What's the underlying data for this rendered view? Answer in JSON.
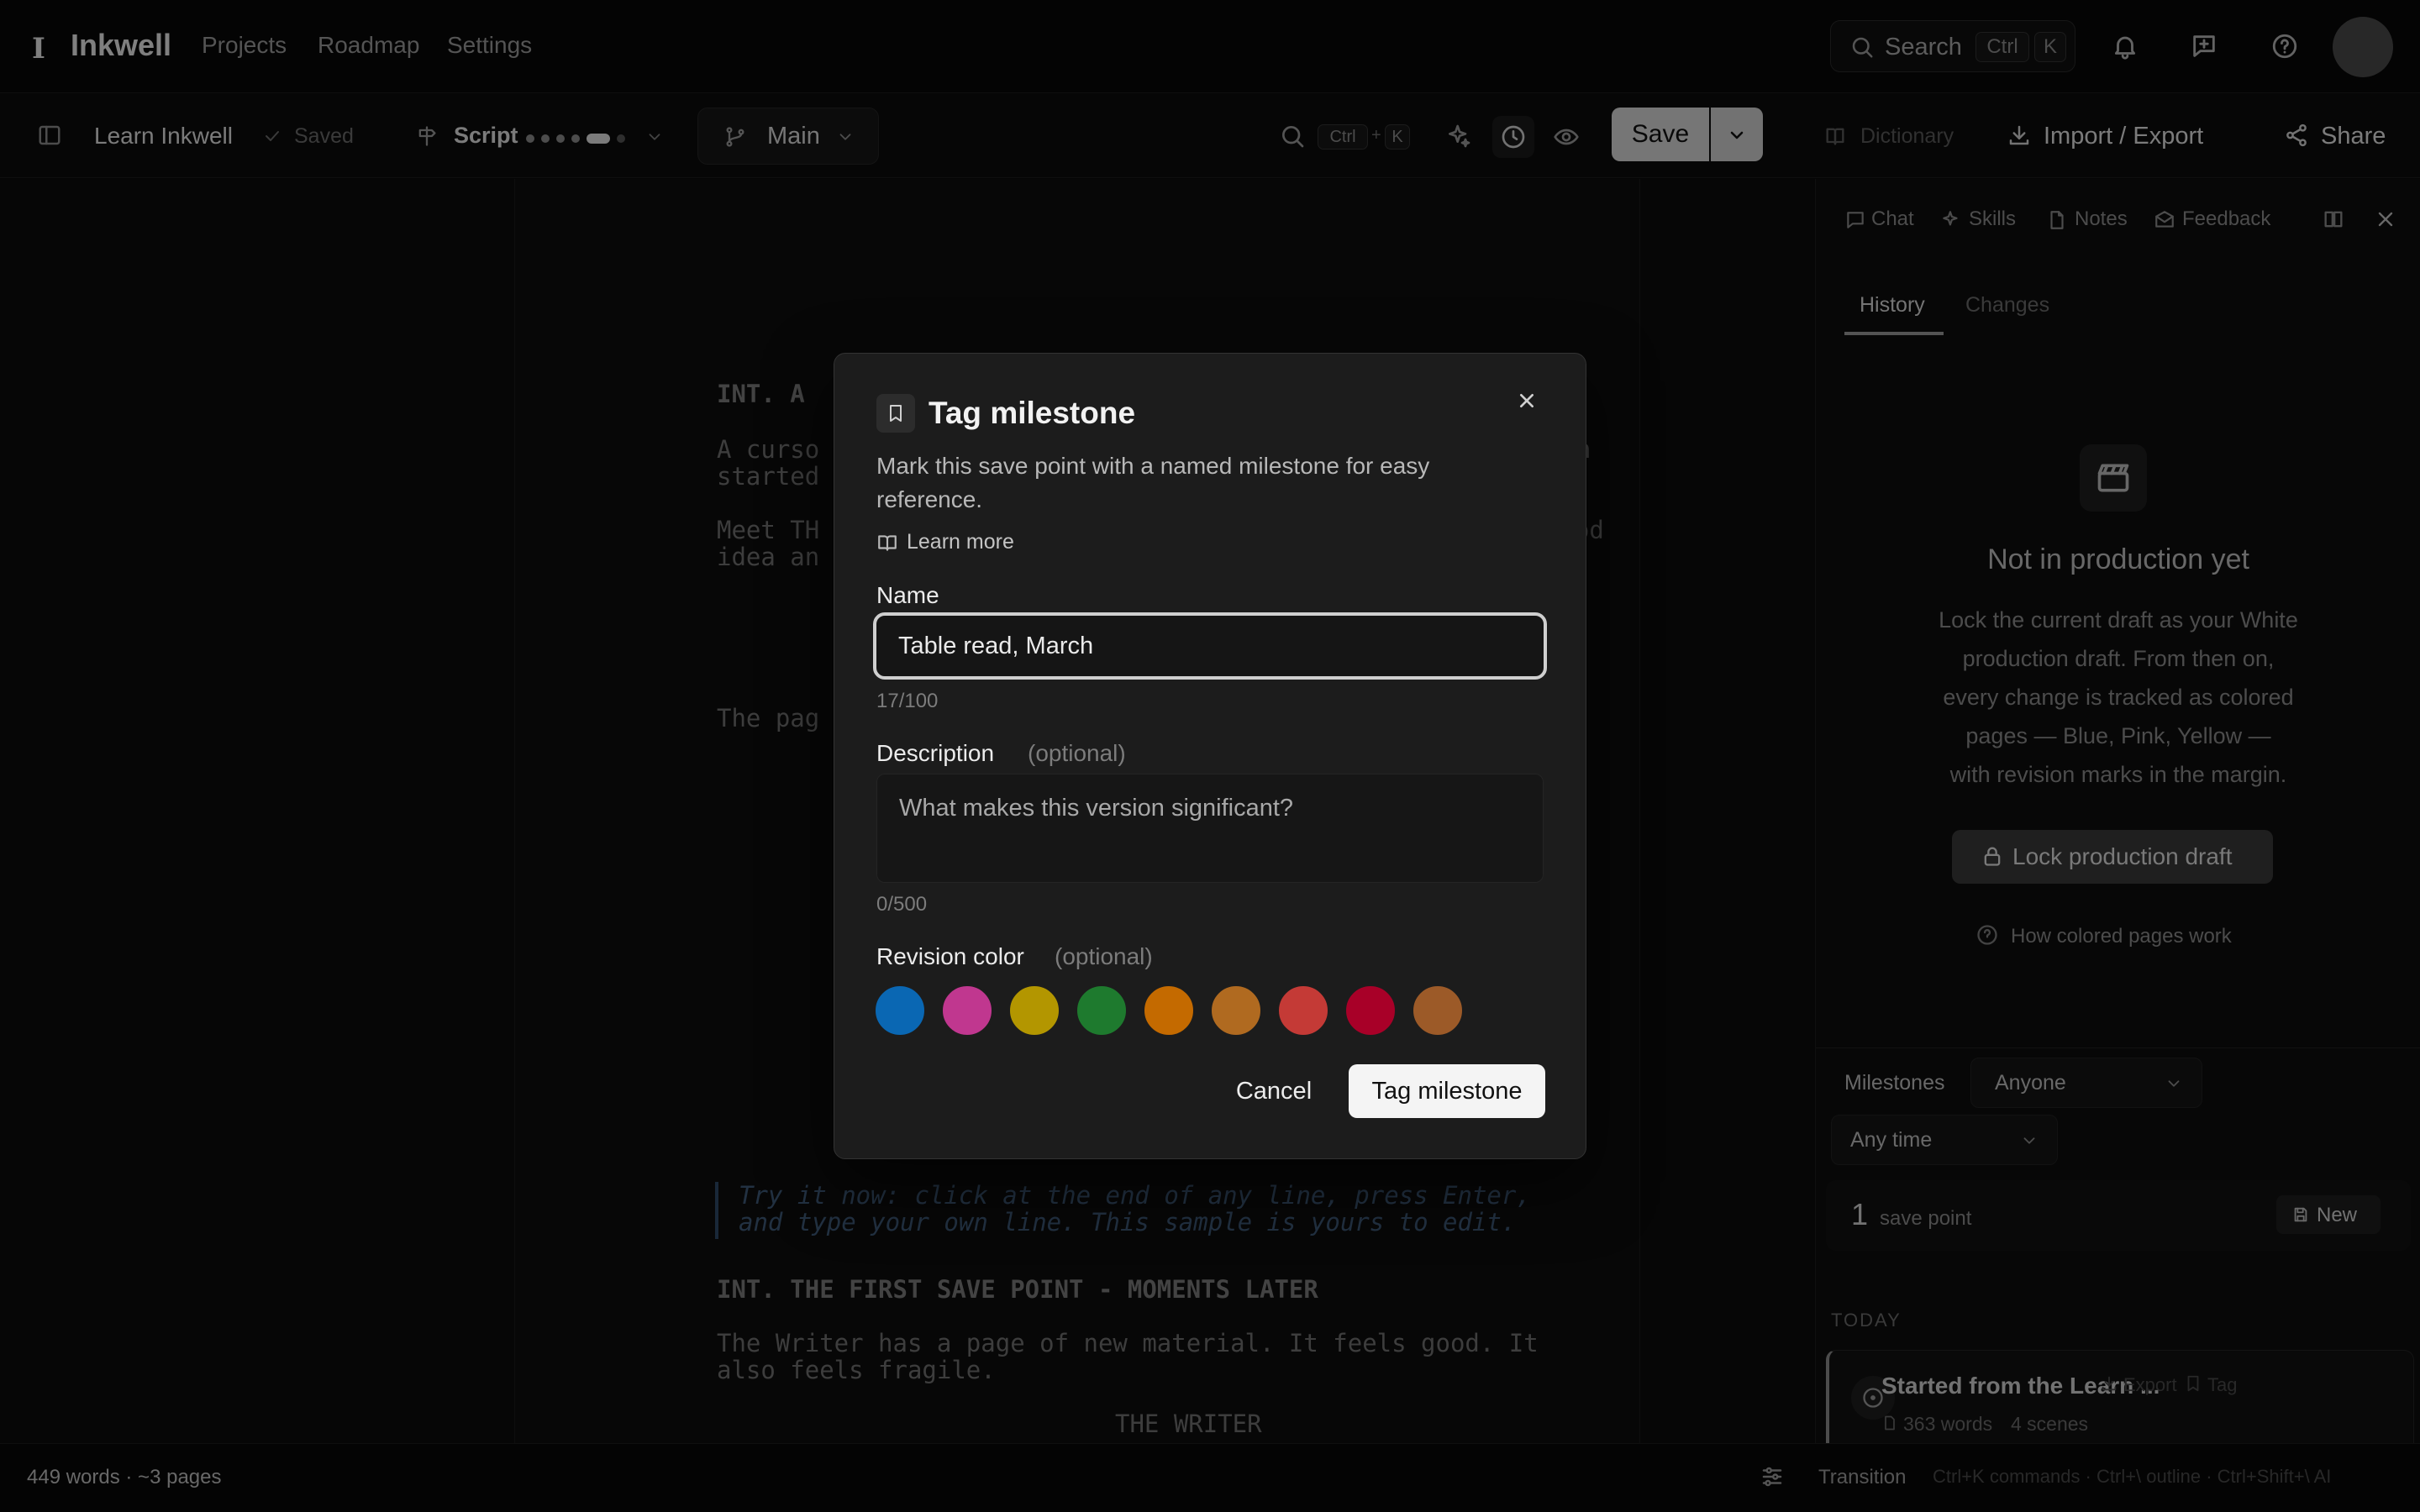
{
  "app": {
    "brand_mark": "I",
    "brand_name": "Inkwell",
    "nav": [
      "Projects",
      "Roadmap",
      "Settings"
    ],
    "search": {
      "label": "Search",
      "key1": "Ctrl",
      "key2": "K"
    }
  },
  "toolbar": {
    "doc_title": "Learn Inkwell",
    "saved_status": "Saved",
    "mode_label": "Script",
    "branch": "Main",
    "find_key1": "Ctrl",
    "find_plus": "+",
    "find_key2": "K",
    "save_label": "Save",
    "dictionary_label": "Dictionary",
    "import_export_label": "Import / Export",
    "share_label": "Share"
  },
  "script": {
    "l1": "INT. A",
    "l2a": "A curso",
    "l2a_end": "ten",
    "l2b": "started",
    "l3a": "Meet TH",
    "l3a_end": "good",
    "l3b": "idea an",
    "l4": "The pag",
    "note1": "Try it now: click at the end of any line, press Enter,",
    "note2": "and type your own line. This sample is yours to edit.",
    "scene2": "INT. THE FIRST SAVE POINT - MOMENTS LATER",
    "action1": "The Writer has a page of new material. It feels good. It",
    "action2": "also feels fragile.",
    "character": "THE WRITER"
  },
  "panel": {
    "tabs": [
      "Chat",
      "Skills",
      "Notes",
      "Feedback"
    ],
    "subtabs": {
      "history": "History",
      "changes": "Changes"
    },
    "empty_title": "Not in production yet",
    "empty_lines": [
      "Lock the current draft as your White",
      "production draft. From then on,",
      "every change is tracked as colored",
      "pages — Blue, Pink, Yellow —",
      "with revision marks in the margin."
    ],
    "lock_label": "Lock production draft",
    "help_link": "How colored pages work",
    "milestones_label": "Milestones",
    "author_filter": "Anyone",
    "time_filter": "Any time",
    "save_count": "1",
    "save_count_label": "save point",
    "new_label": "New",
    "group_label": "TODAY",
    "entry_title": "Started from the Learn ...",
    "entry_export": "Export",
    "entry_tag": "Tag",
    "entry_words": "363 words",
    "entry_scenes": "4 scenes"
  },
  "statusbar": {
    "counts": "449 words · ~3 pages",
    "element": "Transition",
    "hints": "Ctrl+K commands · Ctrl+\\ outline · Ctrl+Shift+\\ AI"
  },
  "modal": {
    "title": "Tag milestone",
    "subtitle_l1": "Mark this save point with a named milestone for easy",
    "subtitle_l2": "reference.",
    "learn_more": "Learn more",
    "name_label": "Name",
    "name_value": "Table read, March",
    "name_counter": "17/100",
    "desc_label": "Description",
    "desc_optional": "(optional)",
    "desc_placeholder": "What makes this version significant?",
    "desc_counter": "0/500",
    "color_label": "Revision color",
    "color_optional": "(optional)",
    "colors": [
      "#0a67b3",
      "#c0378f",
      "#b39600",
      "#1e7a2e",
      "#c46a00",
      "#b06a20",
      "#c43a36",
      "#a80028",
      "#9c5a28"
    ],
    "cancel_label": "Cancel",
    "confirm_label": "Tag milestone"
  }
}
